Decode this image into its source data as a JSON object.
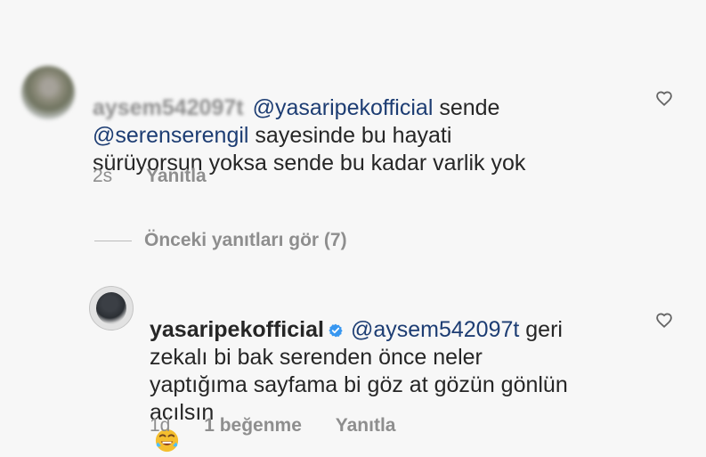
{
  "comment1": {
    "username": "aysem542097t",
    "mention1": "@yasaripekofficial",
    "text_after_mention1": " sende",
    "mention2": "@serenserengil",
    "text_after_mention2": " sayesinde bu hayati\nsürüyorsun yoksa sende bu kadar varlik yok",
    "time": "2s",
    "reply_label": "Yanıtla"
  },
  "replies_link": {
    "label": "Önceki yanıtları gör (7)"
  },
  "comment2": {
    "username": "yasaripekofficial",
    "mention": "@aysem542097t",
    "text_after_mention": " geri\nzekalı bi bak serenden önce neler\nyaptığıma sayfama bi göz at gözün gönlün\nacılsın",
    "time": "1d",
    "likes": "1 beğenme",
    "reply_label": "Yanıtla"
  },
  "icons": {
    "heart1": "heart-icon",
    "heart2": "heart-icon",
    "verified": "verified-badge-icon",
    "emoji": "rofl-emoji-icon"
  },
  "colors": {
    "background": "#f7f7f7",
    "text": "#262626",
    "muted": "#8e8e8e",
    "mention": "#1d3d73",
    "verified": "#3897f0"
  }
}
